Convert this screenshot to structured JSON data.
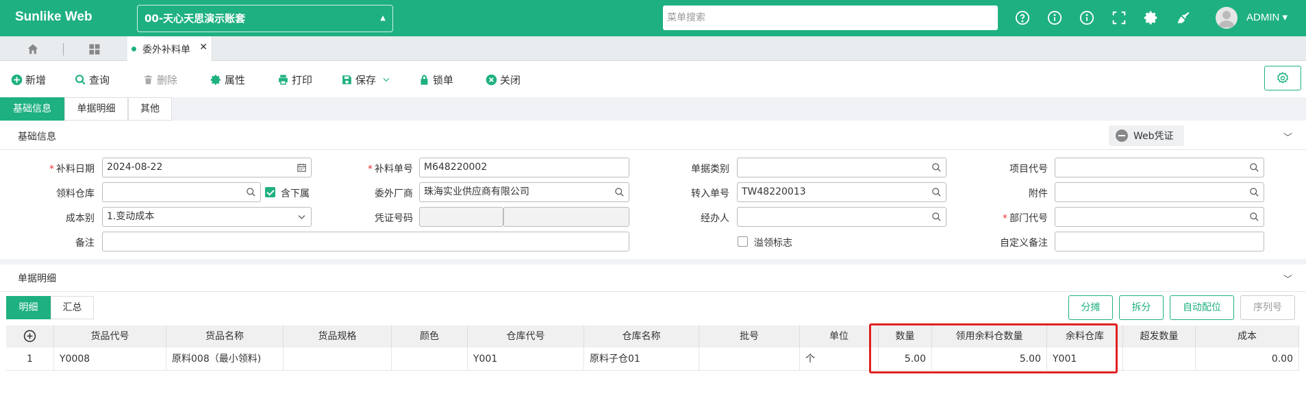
{
  "app": {
    "brand": "Sunlike Web",
    "account": "00-天心天思演示账套",
    "search_placeholder": "菜单搜索",
    "user": "ADMIN"
  },
  "tabs": {
    "active_label": "委外补料单"
  },
  "toolbar": {
    "add": "新增",
    "query": "查询",
    "delete": "删除",
    "attributes": "属性",
    "print": "打印",
    "save": "保存",
    "lock": "锁单",
    "close": "关闭"
  },
  "form_tabs": [
    "基础信息",
    "单据明细",
    "其他"
  ],
  "basic": {
    "section_title": "基础信息",
    "web_voucher": "Web凭证",
    "fields": {
      "bl_date_label": "补料日期",
      "bl_date": "2024-08-22",
      "bl_no_label": "补料单号",
      "bl_no": "M648220002",
      "doc_type_label": "单据类别",
      "doc_type": "",
      "project_label": "项目代号",
      "project": "",
      "wh_label": "领料仓库",
      "wh": "",
      "include_sub_label": "含下属",
      "vendor_label": "委外厂商",
      "vendor": "珠海实业供应商有限公司",
      "transfer_label": "转入单号",
      "transfer": "TW48220013",
      "attach_label": "附件",
      "attach": "",
      "cost_label": "成本别",
      "cost": "1.变动成本",
      "voucher_label": "凭证号码",
      "handler_label": "经办人",
      "handler": "",
      "dept_label": "部门代号",
      "dept": "",
      "remark_label": "备注",
      "remark": "",
      "overflow_label": "溢领标志",
      "custom_remark_label": "自定义备注",
      "custom_remark": ""
    }
  },
  "detail": {
    "section_title": "单据明细",
    "sub_tabs": [
      "明细",
      "汇总"
    ],
    "buttons": {
      "share": "分摊",
      "split": "拆分",
      "auto_loc": "自动配位",
      "serial": "序列号"
    },
    "columns": [
      "货品代号",
      "货品名称",
      "货品规格",
      "颜色",
      "仓库代号",
      "仓库名称",
      "批号",
      "单位",
      "数量",
      "领用余料仓数量",
      "余料仓库",
      "超发数量",
      "成本"
    ],
    "rows": [
      {
        "idx": "1",
        "code": "Y0008",
        "name": "原料008（最小领料)",
        "spec": "",
        "color": "",
        "wh_code": "Y001",
        "wh_name": "原料子仓01",
        "batch": "",
        "unit": "个",
        "qty": "5.00",
        "surplus_qty": "5.00",
        "surplus_wh": "Y001",
        "over_qty": "",
        "cost": "0.00"
      }
    ]
  },
  "colors": {
    "primary": "#1eb081",
    "highlight": "#e02020"
  }
}
